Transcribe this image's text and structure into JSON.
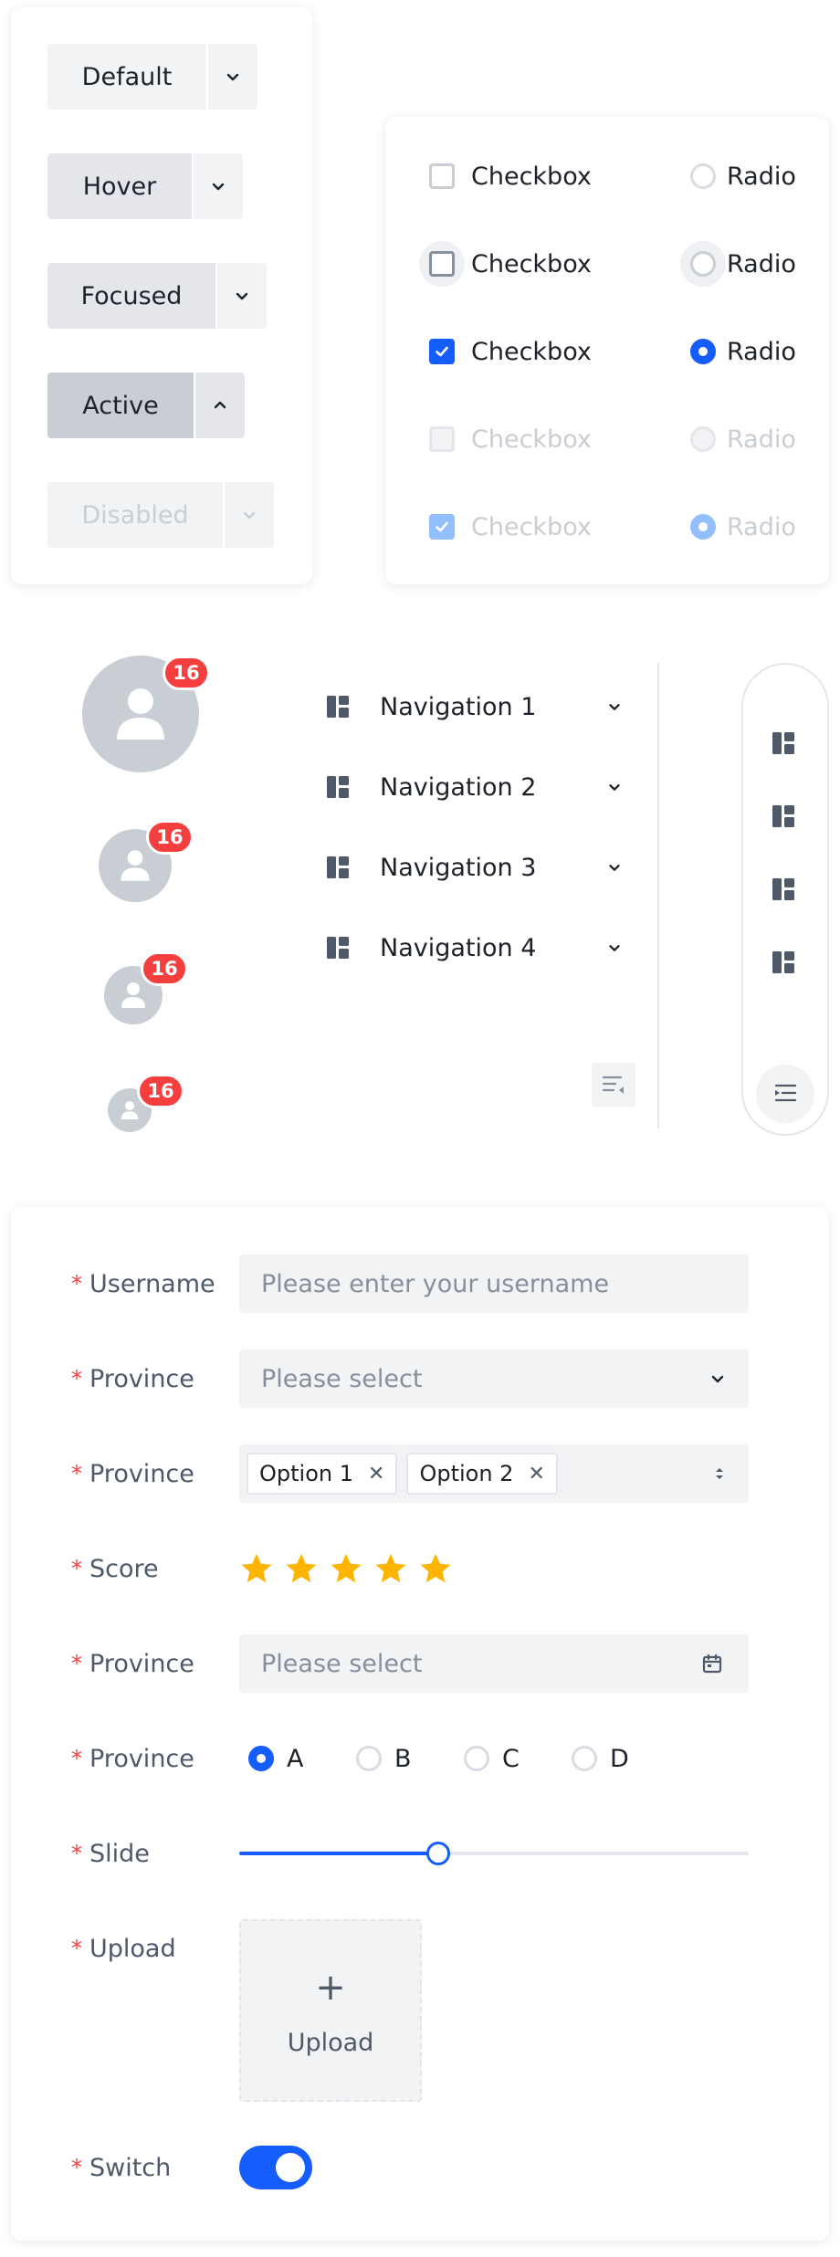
{
  "buttons": {
    "default": "Default",
    "hover": "Hover",
    "focused": "Focused",
    "active": "Active",
    "disabled": "Disabled"
  },
  "choices": {
    "checkbox_label": "Checkbox",
    "radio_label": "Radio",
    "rows": [
      {
        "state": "default",
        "checked": false
      },
      {
        "state": "hover",
        "checked": false
      },
      {
        "state": "checked",
        "checked": true
      },
      {
        "state": "disabled",
        "checked": false
      },
      {
        "state": "disabled-checked",
        "checked": true
      }
    ]
  },
  "avatars": {
    "badge_count": "16"
  },
  "navigation": {
    "items": [
      "Navigation 1",
      "Navigation 2",
      "Navigation 3",
      "Navigation 4"
    ],
    "item_icon": "layout-grid-icon",
    "collapse_icon": "menu-fold-icon"
  },
  "form": {
    "username_label": "Username",
    "username_placeholder": "Please enter your username",
    "province_label": "Province",
    "select_placeholder": "Please select",
    "tags": [
      "Option 1",
      "Option 2"
    ],
    "score_label": "Score",
    "score_value": 5,
    "score_max": 5,
    "date_placeholder": "Please select",
    "radio_options": [
      "A",
      "B",
      "C",
      "D"
    ],
    "radio_selected": "A",
    "slide_label": "Slide",
    "slide_value": 0.39,
    "upload_label": "Upload",
    "upload_plus": "+",
    "upload_text": "Upload",
    "switch_label": "Switch",
    "switch_on": true,
    "required_mark": "*"
  },
  "colors": {
    "primary": "#165dff",
    "danger": "#f53f3f",
    "star": "#ffb400"
  }
}
